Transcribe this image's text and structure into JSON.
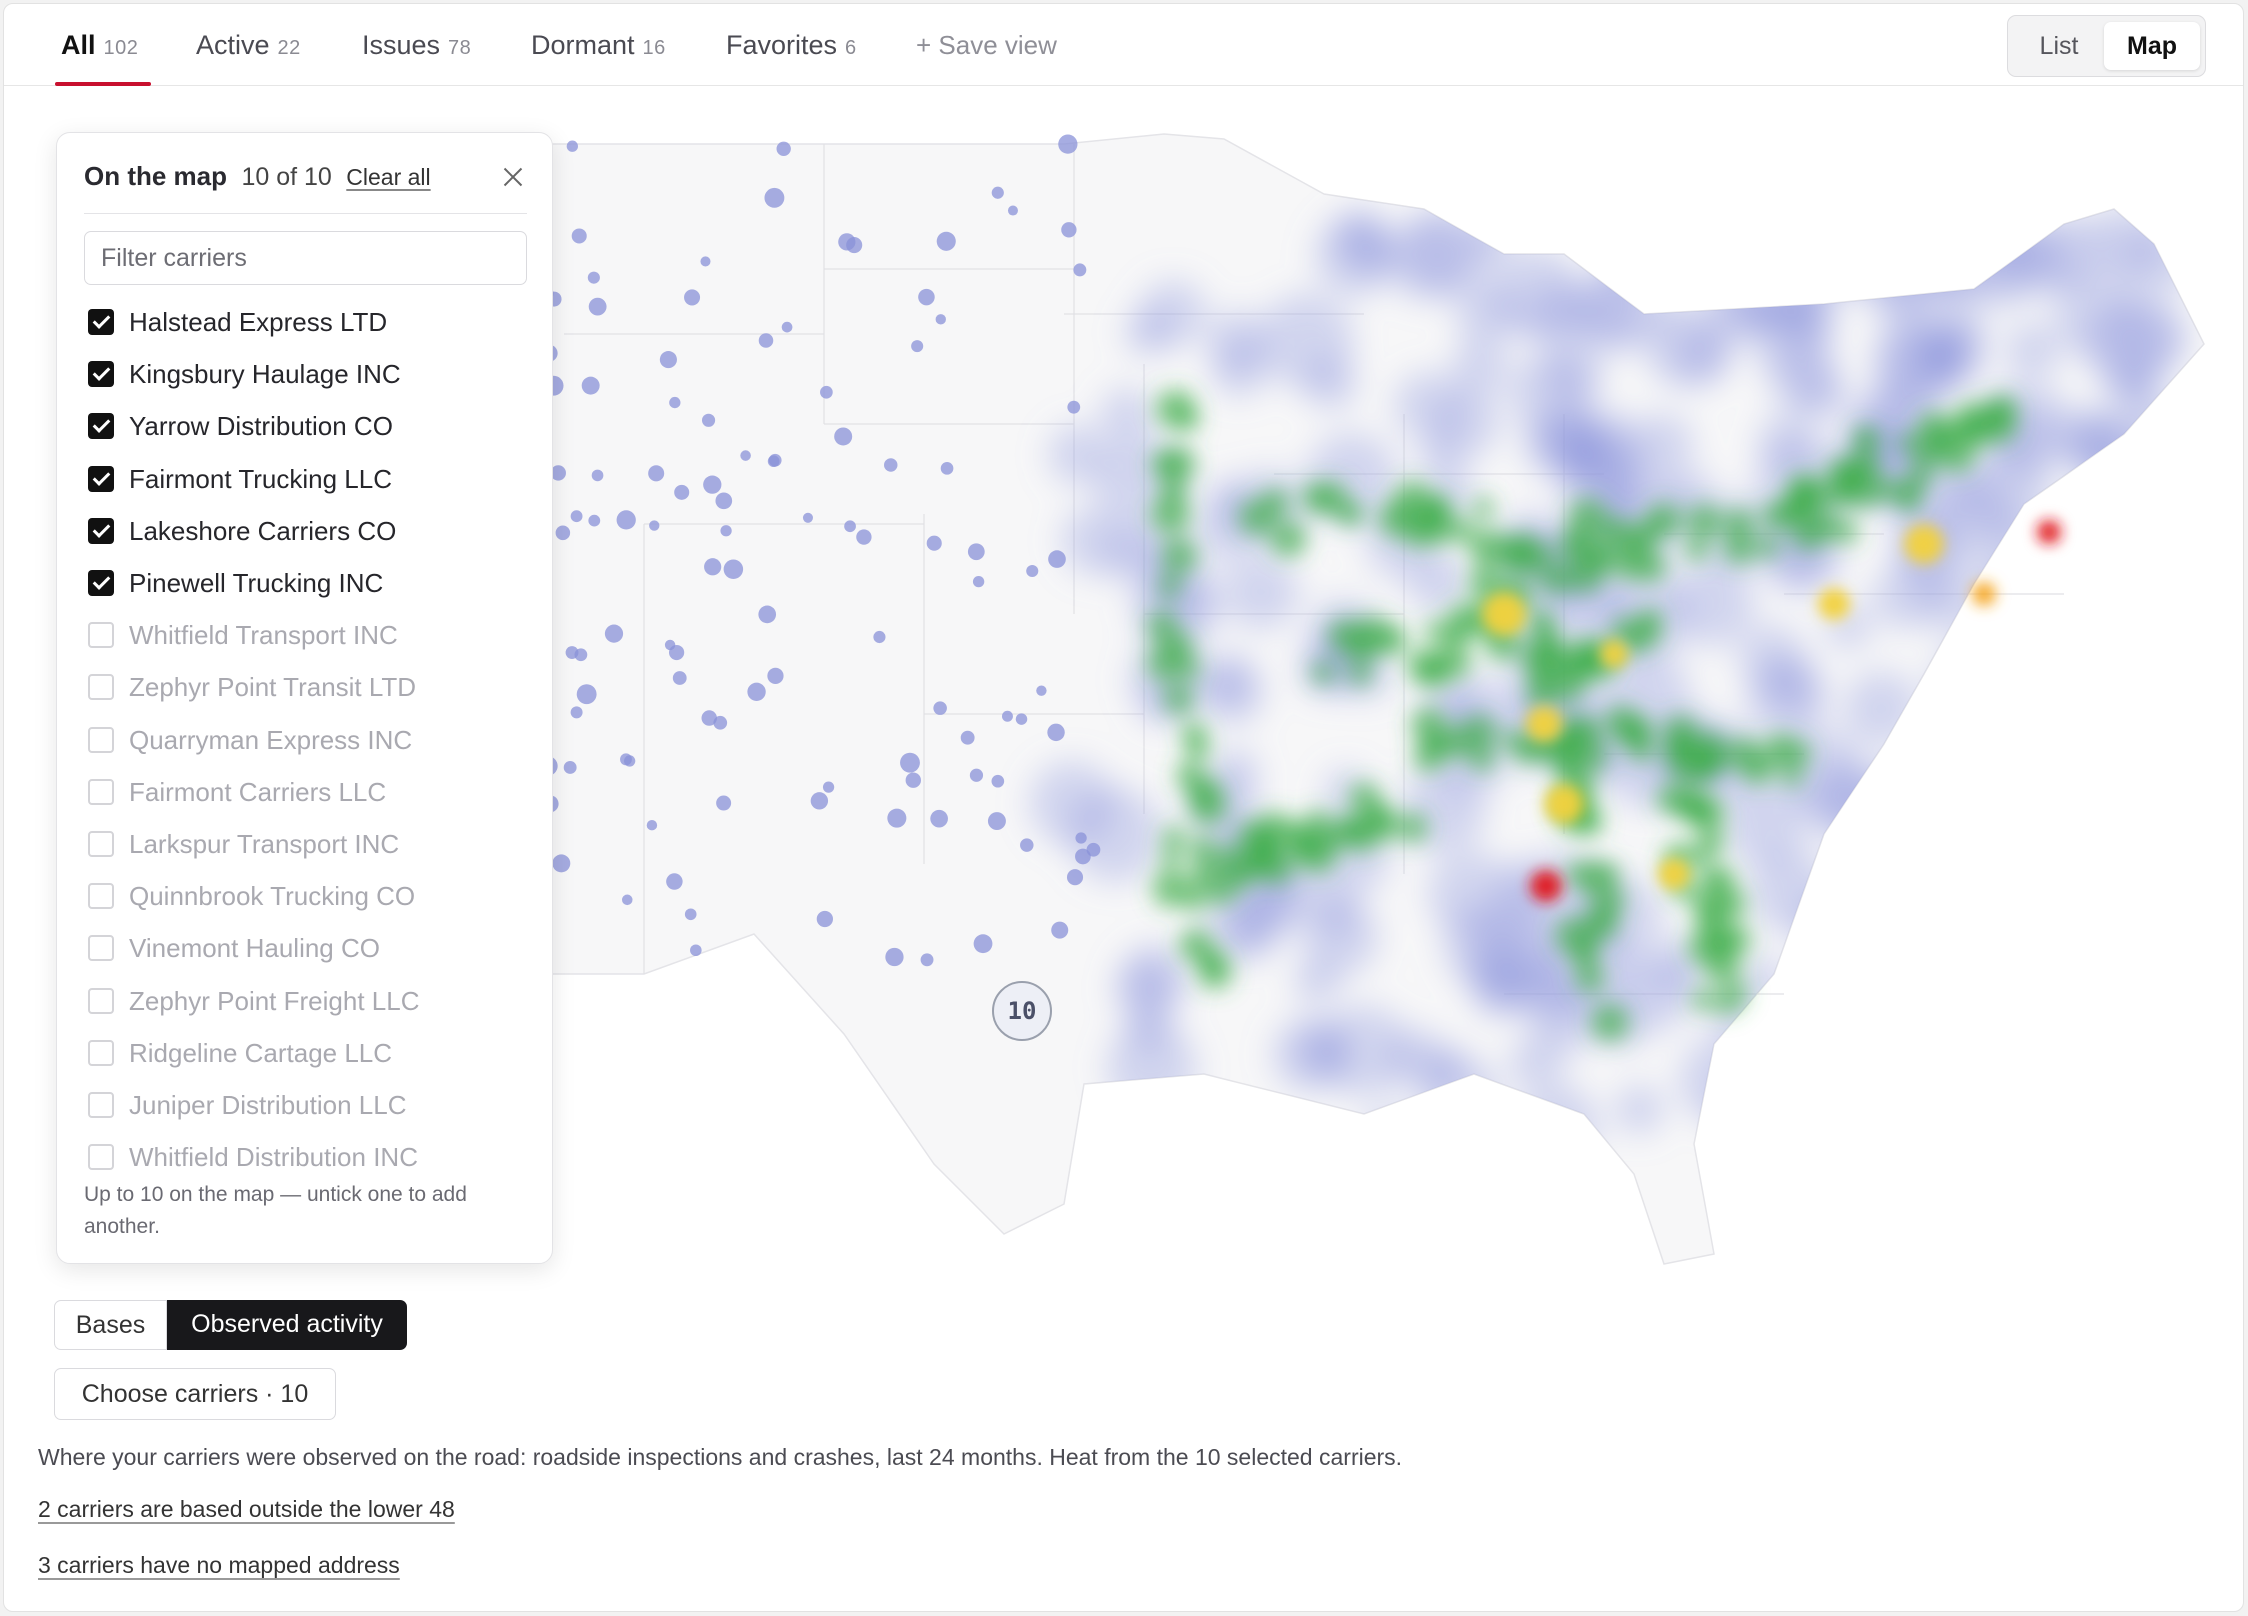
{
  "tabs": [
    {
      "label": "All",
      "count": "102"
    },
    {
      "label": "Active",
      "count": "22"
    },
    {
      "label": "Issues",
      "count": "78"
    },
    {
      "label": "Dormant",
      "count": "16"
    },
    {
      "label": "Favorites",
      "count": "6"
    }
  ],
  "active_tab": "All",
  "save_view_label": "+ Save view",
  "view_toggle": {
    "list": "List",
    "map": "Map",
    "selected": "Map"
  },
  "panel": {
    "title": "On the map",
    "count": "10 of 10",
    "clear_all": "Clear all",
    "filter_placeholder": "Filter carriers",
    "carriers": [
      {
        "name": "Halstead Express LTD",
        "checked": true
      },
      {
        "name": "Kingsbury Haulage INC",
        "checked": true
      },
      {
        "name": "Yarrow Distribution CO",
        "checked": true
      },
      {
        "name": "Fairmont Trucking LLC",
        "checked": true
      },
      {
        "name": "Lakeshore Carriers CO",
        "checked": true
      },
      {
        "name": "Pinewell Trucking INC",
        "checked": true
      },
      {
        "name": "Whitfield Transport INC",
        "checked": false
      },
      {
        "name": "Zephyr Point Transit LTD",
        "checked": false
      },
      {
        "name": "Quarryman Express INC",
        "checked": false
      },
      {
        "name": "Fairmont Carriers LLC",
        "checked": false
      },
      {
        "name": "Larkspur Transport INC",
        "checked": false
      },
      {
        "name": "Quinnbrook Trucking CO",
        "checked": false
      },
      {
        "name": "Vinemont Hauling CO",
        "checked": false
      },
      {
        "name": "Zephyr Point Freight LLC",
        "checked": false
      },
      {
        "name": "Ridgeline Cartage LLC",
        "checked": false
      },
      {
        "name": "Juniper Distribution LLC",
        "checked": false
      },
      {
        "name": "Whitfield Distribution INC",
        "checked": false
      }
    ],
    "note": "Up to 10 on the map — untick one to add another."
  },
  "map": {
    "cluster_count": "10"
  },
  "mode_toggle": {
    "bases": "Bases",
    "activity": "Observed activity",
    "selected": "Observed activity"
  },
  "choose_carriers": "Choose carriers · 10",
  "description": "Where your carriers were observed on the road: roadside inspections and crashes, last 24 months. Heat from the 10 selected carriers.",
  "links": {
    "outside_lower48": "2 carriers are based outside the lower 48",
    "no_address": "3 carriers have no mapped address"
  },
  "colors": {
    "accent": "#c8102e",
    "heat_low": "#7c86d6",
    "heat_mid": "#3fae4a",
    "heat_high": "#f2d23c",
    "heat_peak": "#e0171f"
  }
}
